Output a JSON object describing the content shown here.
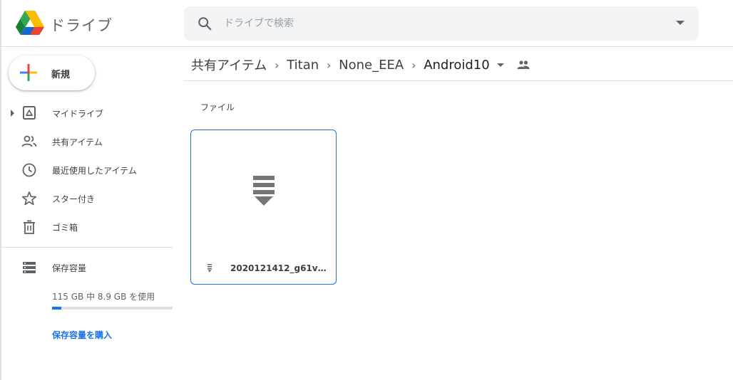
{
  "app": {
    "title": "ドライブ"
  },
  "search": {
    "placeholder": "ドライブで検索"
  },
  "sidebar": {
    "new_label": "新規",
    "items": [
      {
        "label": "マイドライブ",
        "icon": "my-drive-icon"
      },
      {
        "label": "共有アイテム",
        "icon": "shared-icon"
      },
      {
        "label": "最近使用したアイテム",
        "icon": "clock-icon"
      },
      {
        "label": "スター付き",
        "icon": "star-icon"
      },
      {
        "label": "ゴミ箱",
        "icon": "trash-icon"
      }
    ],
    "storage": {
      "label": "保存容量",
      "usage_text": "115 GB 中 8.9 GB を使用",
      "used_fraction": 0.077,
      "buy_label": "保存容量を購入"
    }
  },
  "breadcrumb": [
    "共有アイテム",
    "Titan",
    "None_EEA",
    "Android10"
  ],
  "main": {
    "section_label": "ファイル",
    "files": [
      {
        "name": "2020121412_g61v71..."
      }
    ]
  },
  "colors": {
    "accent": "#1a73e8",
    "text": "#3c4043",
    "search_bg": "#f1f3f4",
    "divider": "#dadce0"
  }
}
